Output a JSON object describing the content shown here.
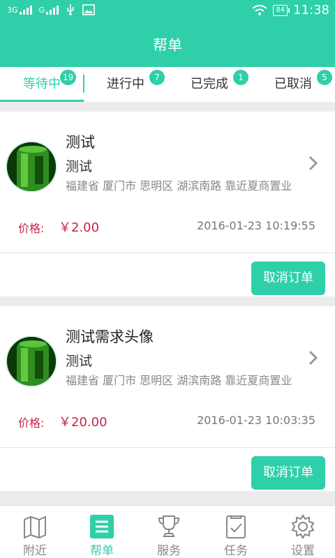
{
  "status_bar": {
    "network_left": "3G",
    "network_right": "G",
    "battery": "84",
    "time": "11:38"
  },
  "header": {
    "title": "帮单"
  },
  "tabs": [
    {
      "label": "等待中",
      "badge": "19",
      "active": true
    },
    {
      "label": "进行中",
      "badge": "7",
      "active": false
    },
    {
      "label": "已完成",
      "badge": "1",
      "active": false
    },
    {
      "label": "已取消",
      "badge": "5",
      "active": false
    }
  ],
  "orders": [
    {
      "title": "测试",
      "subtitle": "测试",
      "address": "福建省 厦门市 思明区 湖滨南路 靠近夏商置业",
      "price_label": "价格:",
      "price": "￥2.00",
      "time": "2016-01-23 10:19:55",
      "cancel_label": "取消订单"
    },
    {
      "title": "测试需求头像",
      "subtitle": "测试",
      "address": "福建省 厦门市 思明区 湖滨南路 靠近夏商置业",
      "price_label": "价格:",
      "price": "￥20.00",
      "time": "2016-01-23 10:03:35",
      "cancel_label": "取消订单"
    }
  ],
  "bottom_nav": [
    {
      "label": "附近",
      "icon": "map-icon",
      "active": false
    },
    {
      "label": "帮单",
      "icon": "list-icon",
      "active": true
    },
    {
      "label": "服务",
      "icon": "trophy-icon",
      "active": false
    },
    {
      "label": "任务",
      "icon": "task-icon",
      "active": false
    },
    {
      "label": "设置",
      "icon": "gear-icon",
      "active": false
    }
  ],
  "colors": {
    "accent": "#2fcfa9",
    "price": "#c8234a"
  }
}
